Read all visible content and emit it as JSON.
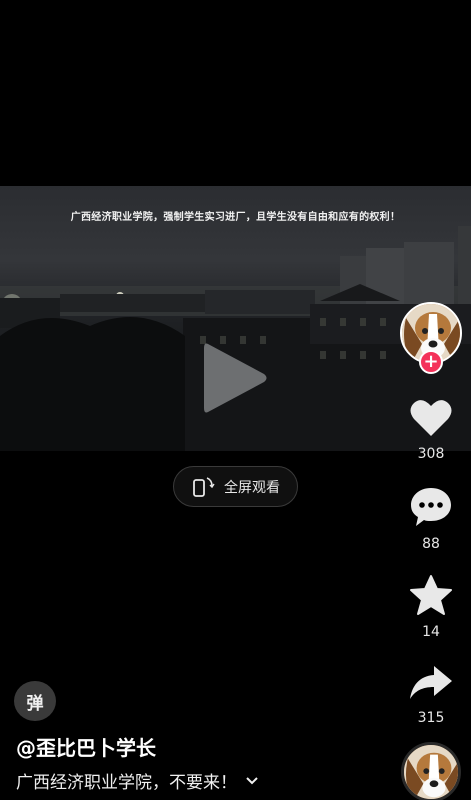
{
  "video": {
    "caption": "广西经济职业学院，强制学生实习进厂，且学生没有自由和应有的权利！"
  },
  "fullscreen": {
    "label": "全屏观看"
  },
  "actions": {
    "like_count": "308",
    "comment_count": "88",
    "favorite_count": "14",
    "share_count": "315"
  },
  "icons": {
    "play": "play-icon",
    "like": "heart-icon",
    "comment": "comment-bubble-icon",
    "favorite": "star-icon",
    "share": "share-arrow-icon",
    "fullscreen": "rotate-phone-icon",
    "expand": "chevron-down-icon"
  },
  "danmu": {
    "label": "弹"
  },
  "post": {
    "author": "@歪比巴卜学长",
    "description": "广西经济职业学院，不要来！"
  },
  "colors": {
    "accent": "#f4325a",
    "background": "#000000"
  }
}
